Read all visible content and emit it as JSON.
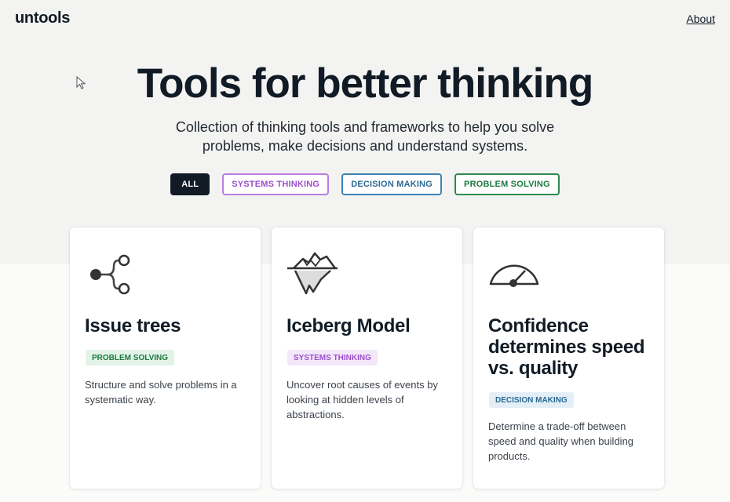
{
  "brand": {
    "logo": "untools"
  },
  "nav": {
    "about": "About"
  },
  "hero": {
    "title": "Tools for better thinking",
    "subtitle": "Collection of thinking tools and frameworks to help you solve problems, make decisions and understand systems."
  },
  "filters": [
    {
      "label": "ALL",
      "active": true
    },
    {
      "label": "SYSTEMS THINKING",
      "active": false
    },
    {
      "label": "DECISION MAKING",
      "active": false
    },
    {
      "label": "PROBLEM SOLVING",
      "active": false
    }
  ],
  "cards": [
    {
      "title": "Issue trees",
      "tag": "PROBLEM SOLVING",
      "description": "Structure and solve problems in a systematic way.",
      "icon": "issue-tree-icon"
    },
    {
      "title": "Iceberg Model",
      "tag": "SYSTEMS THINKING",
      "description": "Uncover root causes of events by looking at hidden levels of abstractions.",
      "icon": "iceberg-icon"
    },
    {
      "title": "Confidence determines speed vs. quality",
      "tag": "DECISION MAKING",
      "description": "Determine a trade-off between speed and quality when building products.",
      "icon": "gauge-icon"
    }
  ],
  "colors": {
    "ink": "#111b26",
    "systems": "#9b4fc9",
    "decision": "#2b6a93",
    "problem": "#1c7a3f"
  }
}
